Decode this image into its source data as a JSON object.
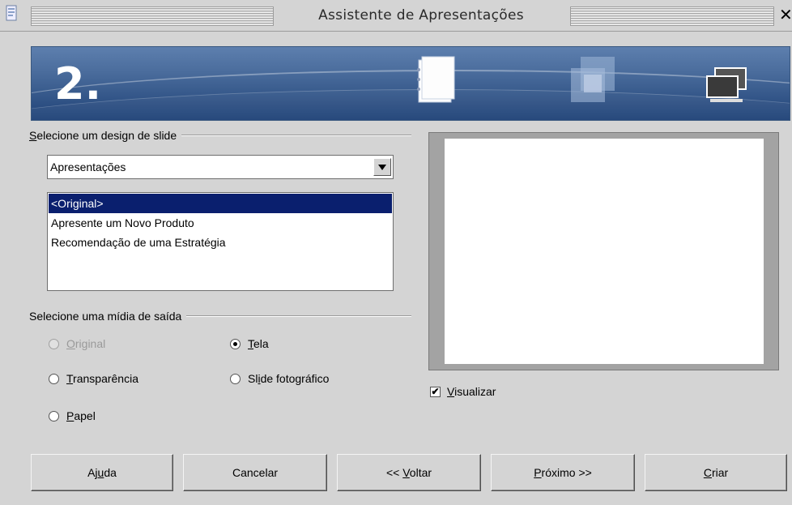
{
  "window": {
    "title": "Assistente de Apresentações",
    "close_glyph": "✕"
  },
  "banner": {
    "step_number": "2."
  },
  "design_section": {
    "legend": "Selecione um design de slide",
    "legend_mnemonic": "S",
    "legend_rest": "elecione um design de slide",
    "category_value": "Apresentações",
    "templates": [
      "<Original>",
      "Apresente um Novo Produto",
      "Recomendação de uma Estratégia"
    ],
    "selected_index": 0
  },
  "output_section": {
    "legend": "Selecione uma mídia de saída",
    "options": [
      {
        "pre": "",
        "mn": "O",
        "post": "riginal",
        "selected": false,
        "disabled": true
      },
      {
        "pre": "",
        "mn": "T",
        "post": "ransparência",
        "selected": false,
        "disabled": false
      },
      {
        "pre": "",
        "mn": "P",
        "post": "apel",
        "selected": false,
        "disabled": false
      },
      {
        "pre": "",
        "mn": "T",
        "post": "ela",
        "selected": true,
        "disabled": false
      },
      {
        "pre": "Sl",
        "mn": "i",
        "post": "de fotográfico",
        "selected": false,
        "disabled": false
      }
    ]
  },
  "preview": {
    "checkbox_pre": "",
    "checkbox_mn": "V",
    "checkbox_post": "isualizar",
    "checked": true,
    "check_glyph": "✔"
  },
  "buttons": {
    "help": {
      "pre": "Aj",
      "mn": "u",
      "post": "da"
    },
    "cancel": {
      "pre": "Cancelar",
      "mn": "",
      "post": ""
    },
    "back": {
      "pre": "<< ",
      "mn": "V",
      "post": "oltar"
    },
    "next": {
      "pre": "",
      "mn": "P",
      "post": "róximo >>"
    },
    "create": {
      "pre": "",
      "mn": "C",
      "post": "riar"
    }
  },
  "icons": [
    "app-icon",
    "step-page-icon",
    "step-layers-icon",
    "step-monitors-icon",
    "combo-arrow-icon",
    "close-icon"
  ]
}
